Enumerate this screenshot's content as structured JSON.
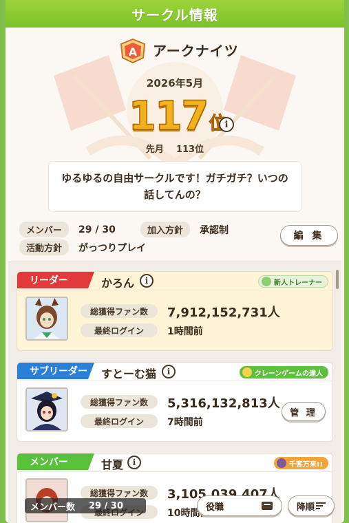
{
  "header": {
    "title": "サークル情報"
  },
  "club": {
    "name": "アークナイツ",
    "period": "2026年5月",
    "rank_number": "117",
    "rank_suffix": "位",
    "prev_label": "先月",
    "prev_rank": "113位",
    "description": "ゆるゆるの自由サークルです！ガチガチ？いつの話してんの？",
    "members_label": "メンバー",
    "members_value": "29 / 30",
    "join_label": "加入方針",
    "join_value": "承認制",
    "policy_label": "活動方針",
    "policy_value": "がっつりプレイ",
    "edit_label": "編 集"
  },
  "members": [
    {
      "role": "リーダー",
      "role_color": "#e23a3a",
      "name": "かろん",
      "badge": "新人トレーナー",
      "badge_bg": "#e6f2dc",
      "badge_color": "#3f7f2a",
      "fans_label": "総獲得ファン数",
      "fans": "7,912,152,731人",
      "login_label": "最終ログイン",
      "login": "1時間前"
    },
    {
      "role": "サブリーダー",
      "role_color": "#2a7fd8",
      "name": "すとーむ猫",
      "badge": "クレーンゲームの達人",
      "badge_bg": "#5fbf3f",
      "badge_color": "#ffffff",
      "fans_label": "総獲得ファン数",
      "fans": "5,316,132,813人",
      "login_label": "最終ログイン",
      "login": "7時間前",
      "manage_label": "管 理"
    },
    {
      "role": "メンバー",
      "role_color": "#58c23a",
      "name": "甘夏",
      "badge": "千客万来!!",
      "badge_bg": "#f2a43a",
      "badge_color": "#ffffff",
      "fans_label": "総獲得ファン数",
      "fans": "3,105,039,407人",
      "login_label": "最終ログイン",
      "login": "10時間前"
    }
  ],
  "footer": {
    "count_label": "メンバー数",
    "count_value": "29 / 30",
    "role_sort_label": "役職",
    "order_label": "降順"
  }
}
